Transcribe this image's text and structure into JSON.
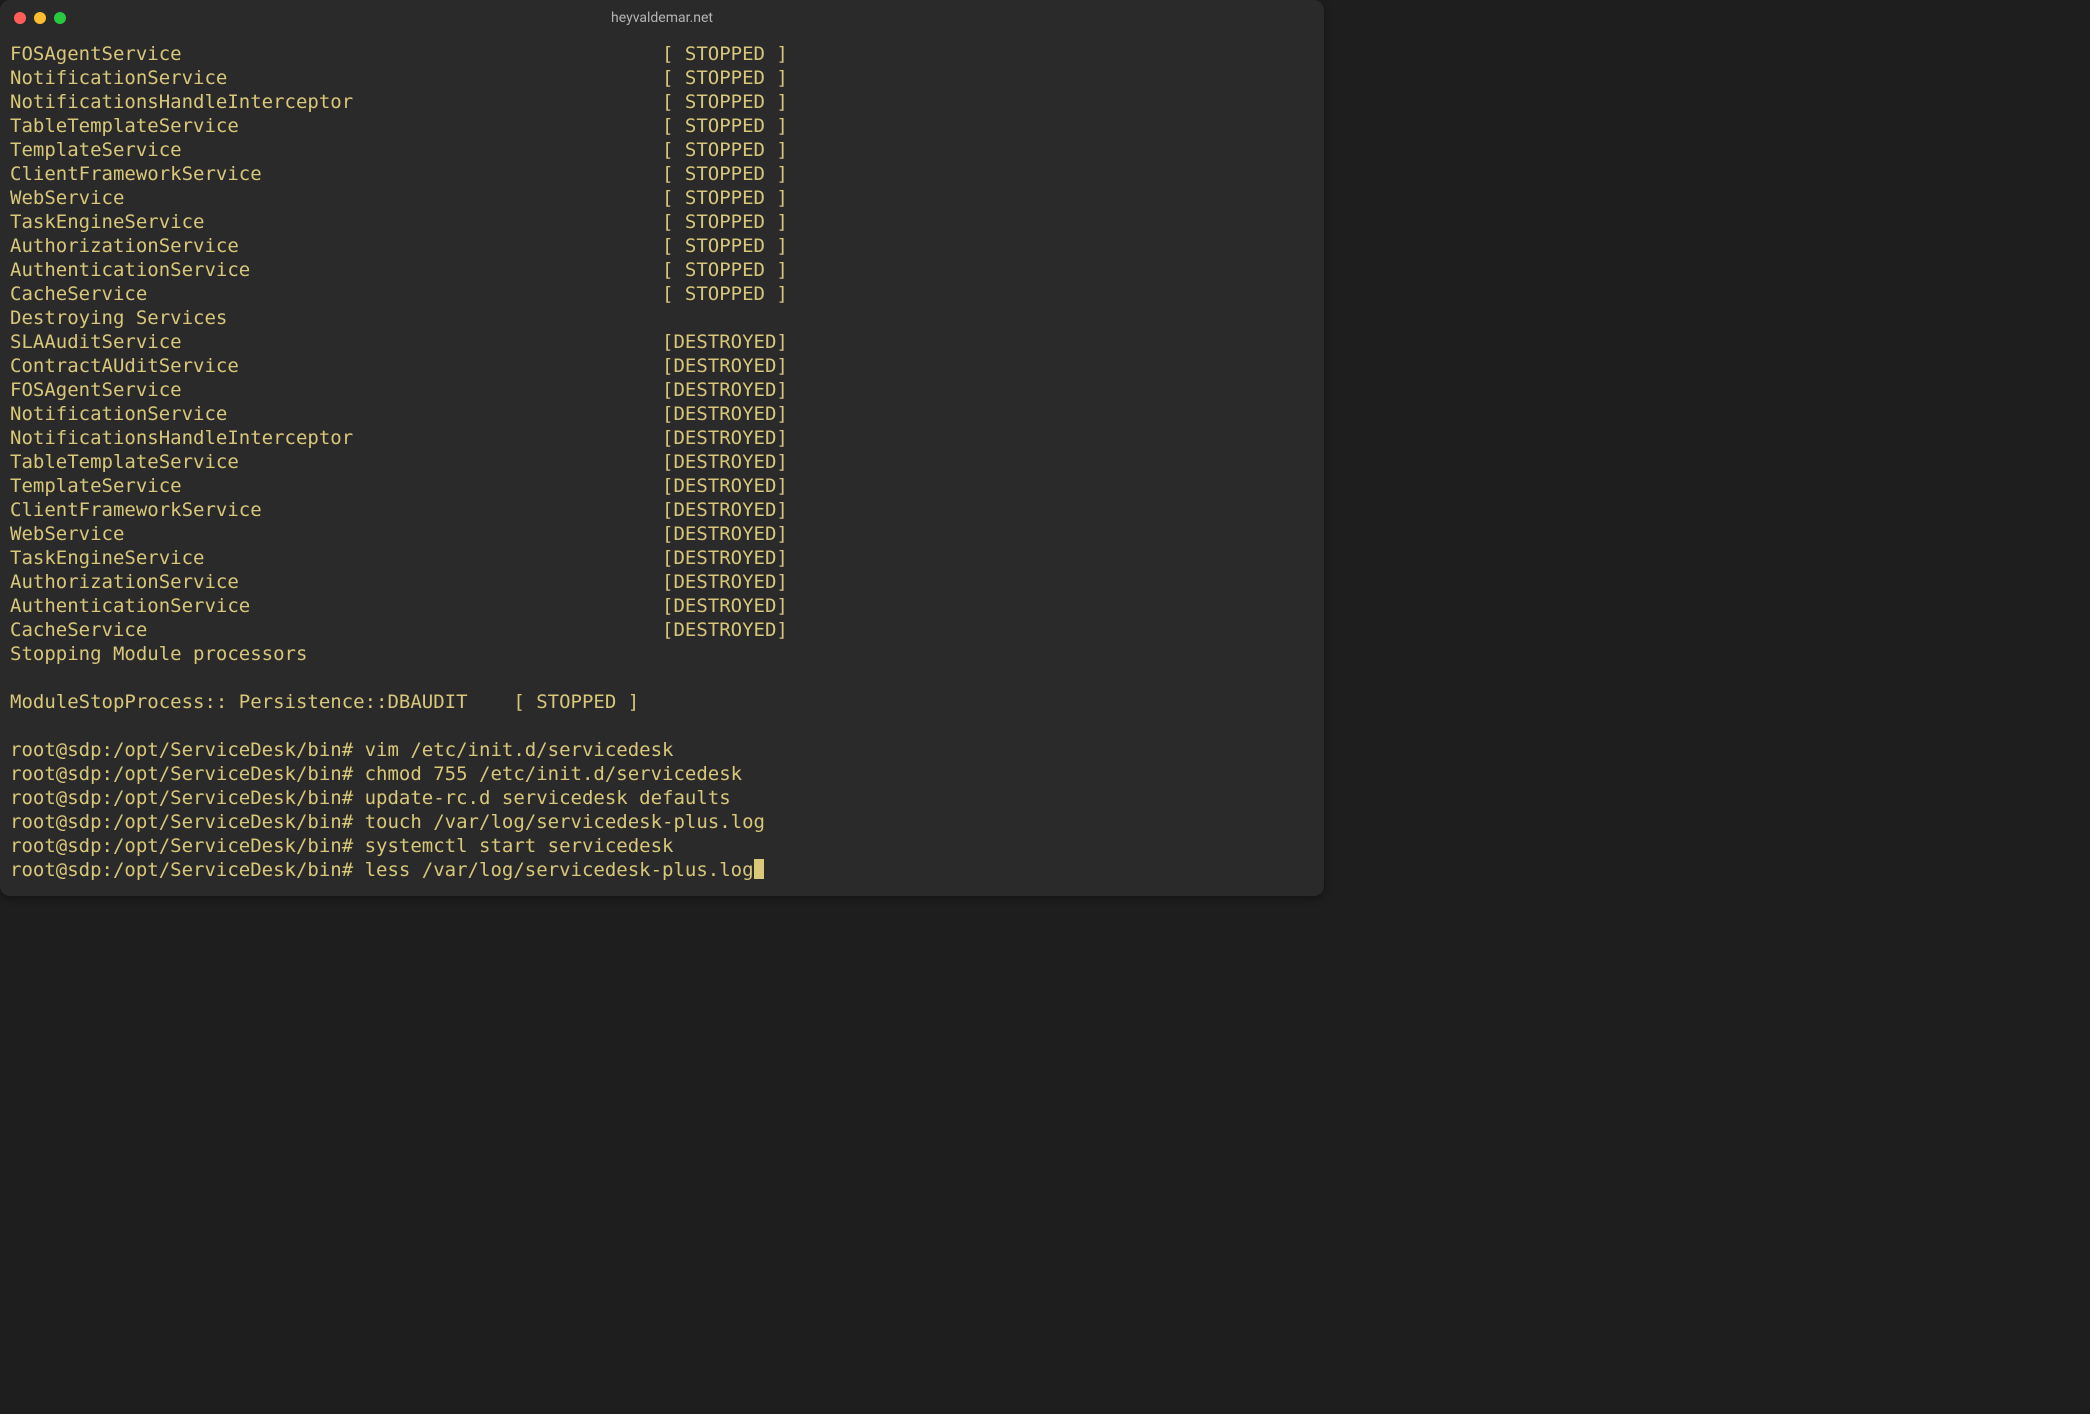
{
  "window": {
    "title": "heyvaldemar.net"
  },
  "colors": {
    "bg": "#2a2a2a",
    "fg": "#d9c77a",
    "title_fg": "#b5b5b5",
    "red": "#ff5f57",
    "yellow": "#febc2e",
    "green": "#28c840"
  },
  "layout": {
    "service_col_width": 57,
    "module_col_width": 44
  },
  "status_labels": {
    "stopped_padded": "[ STOPPED ]",
    "destroyed": "[DESTROYED]",
    "stopped_inline": "[ STOPPED ]"
  },
  "stopped_services": [
    "FOSAgentService",
    "NotificationService",
    "NotificationsHandleInterceptor",
    "TableTemplateService",
    "TemplateService",
    "ClientFrameworkService",
    "WebService",
    "TaskEngineService",
    "AuthorizationService",
    "AuthenticationService",
    "CacheService"
  ],
  "section_labels": {
    "destroying": "Destroying Services",
    "stopping_modules": "Stopping Module processors",
    "module_stop": "ModuleStopProcess:: Persistence::DBAUDIT"
  },
  "destroyed_services": [
    "SLAAuditService",
    "ContractAUditService",
    "FOSAgentService",
    "NotificationService",
    "NotificationsHandleInterceptor",
    "TableTemplateService",
    "TemplateService",
    "ClientFrameworkService",
    "WebService",
    "TaskEngineService",
    "AuthorizationService",
    "AuthenticationService",
    "CacheService"
  ],
  "prompt": "root@sdp:/opt/ServiceDesk/bin#",
  "commands": [
    "vim /etc/init.d/servicedesk",
    "chmod 755 /etc/init.d/servicedesk",
    "update-rc.d servicedesk defaults",
    "touch /var/log/servicedesk-plus.log",
    "systemctl start servicedesk",
    "less /var/log/servicedesk-plus.log"
  ]
}
